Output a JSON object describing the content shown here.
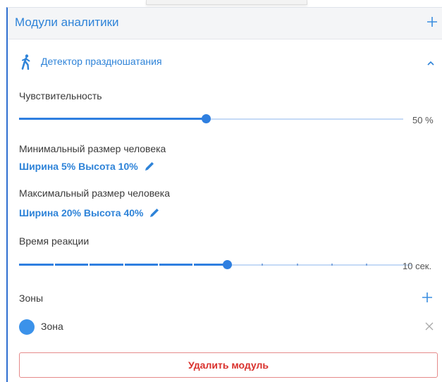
{
  "panel": {
    "title": "Модули аналитики"
  },
  "module": {
    "title": "Детектор праздношатания",
    "icon": "person-walking-icon"
  },
  "sensitivity": {
    "label": "Чувствительность",
    "value_percent": 50,
    "value_text": "50 %"
  },
  "min_size": {
    "label": "Минимальный размер человека",
    "value_text": "Ширина 5% Высота 10%"
  },
  "max_size": {
    "label": "Максимальный размер человека",
    "value_text": "Ширина 20% Высота 40%"
  },
  "reaction_time": {
    "label": "Время реакции",
    "value": 6,
    "steps": 11,
    "value_text": "10 сек."
  },
  "zones": {
    "label": "Зоны",
    "items": [
      {
        "name": "Зона",
        "color": "#3b92ea"
      }
    ]
  },
  "actions": {
    "delete_label": "Удалить модуль"
  },
  "colors": {
    "accent": "#2e83d8",
    "danger": "#d9302c"
  }
}
